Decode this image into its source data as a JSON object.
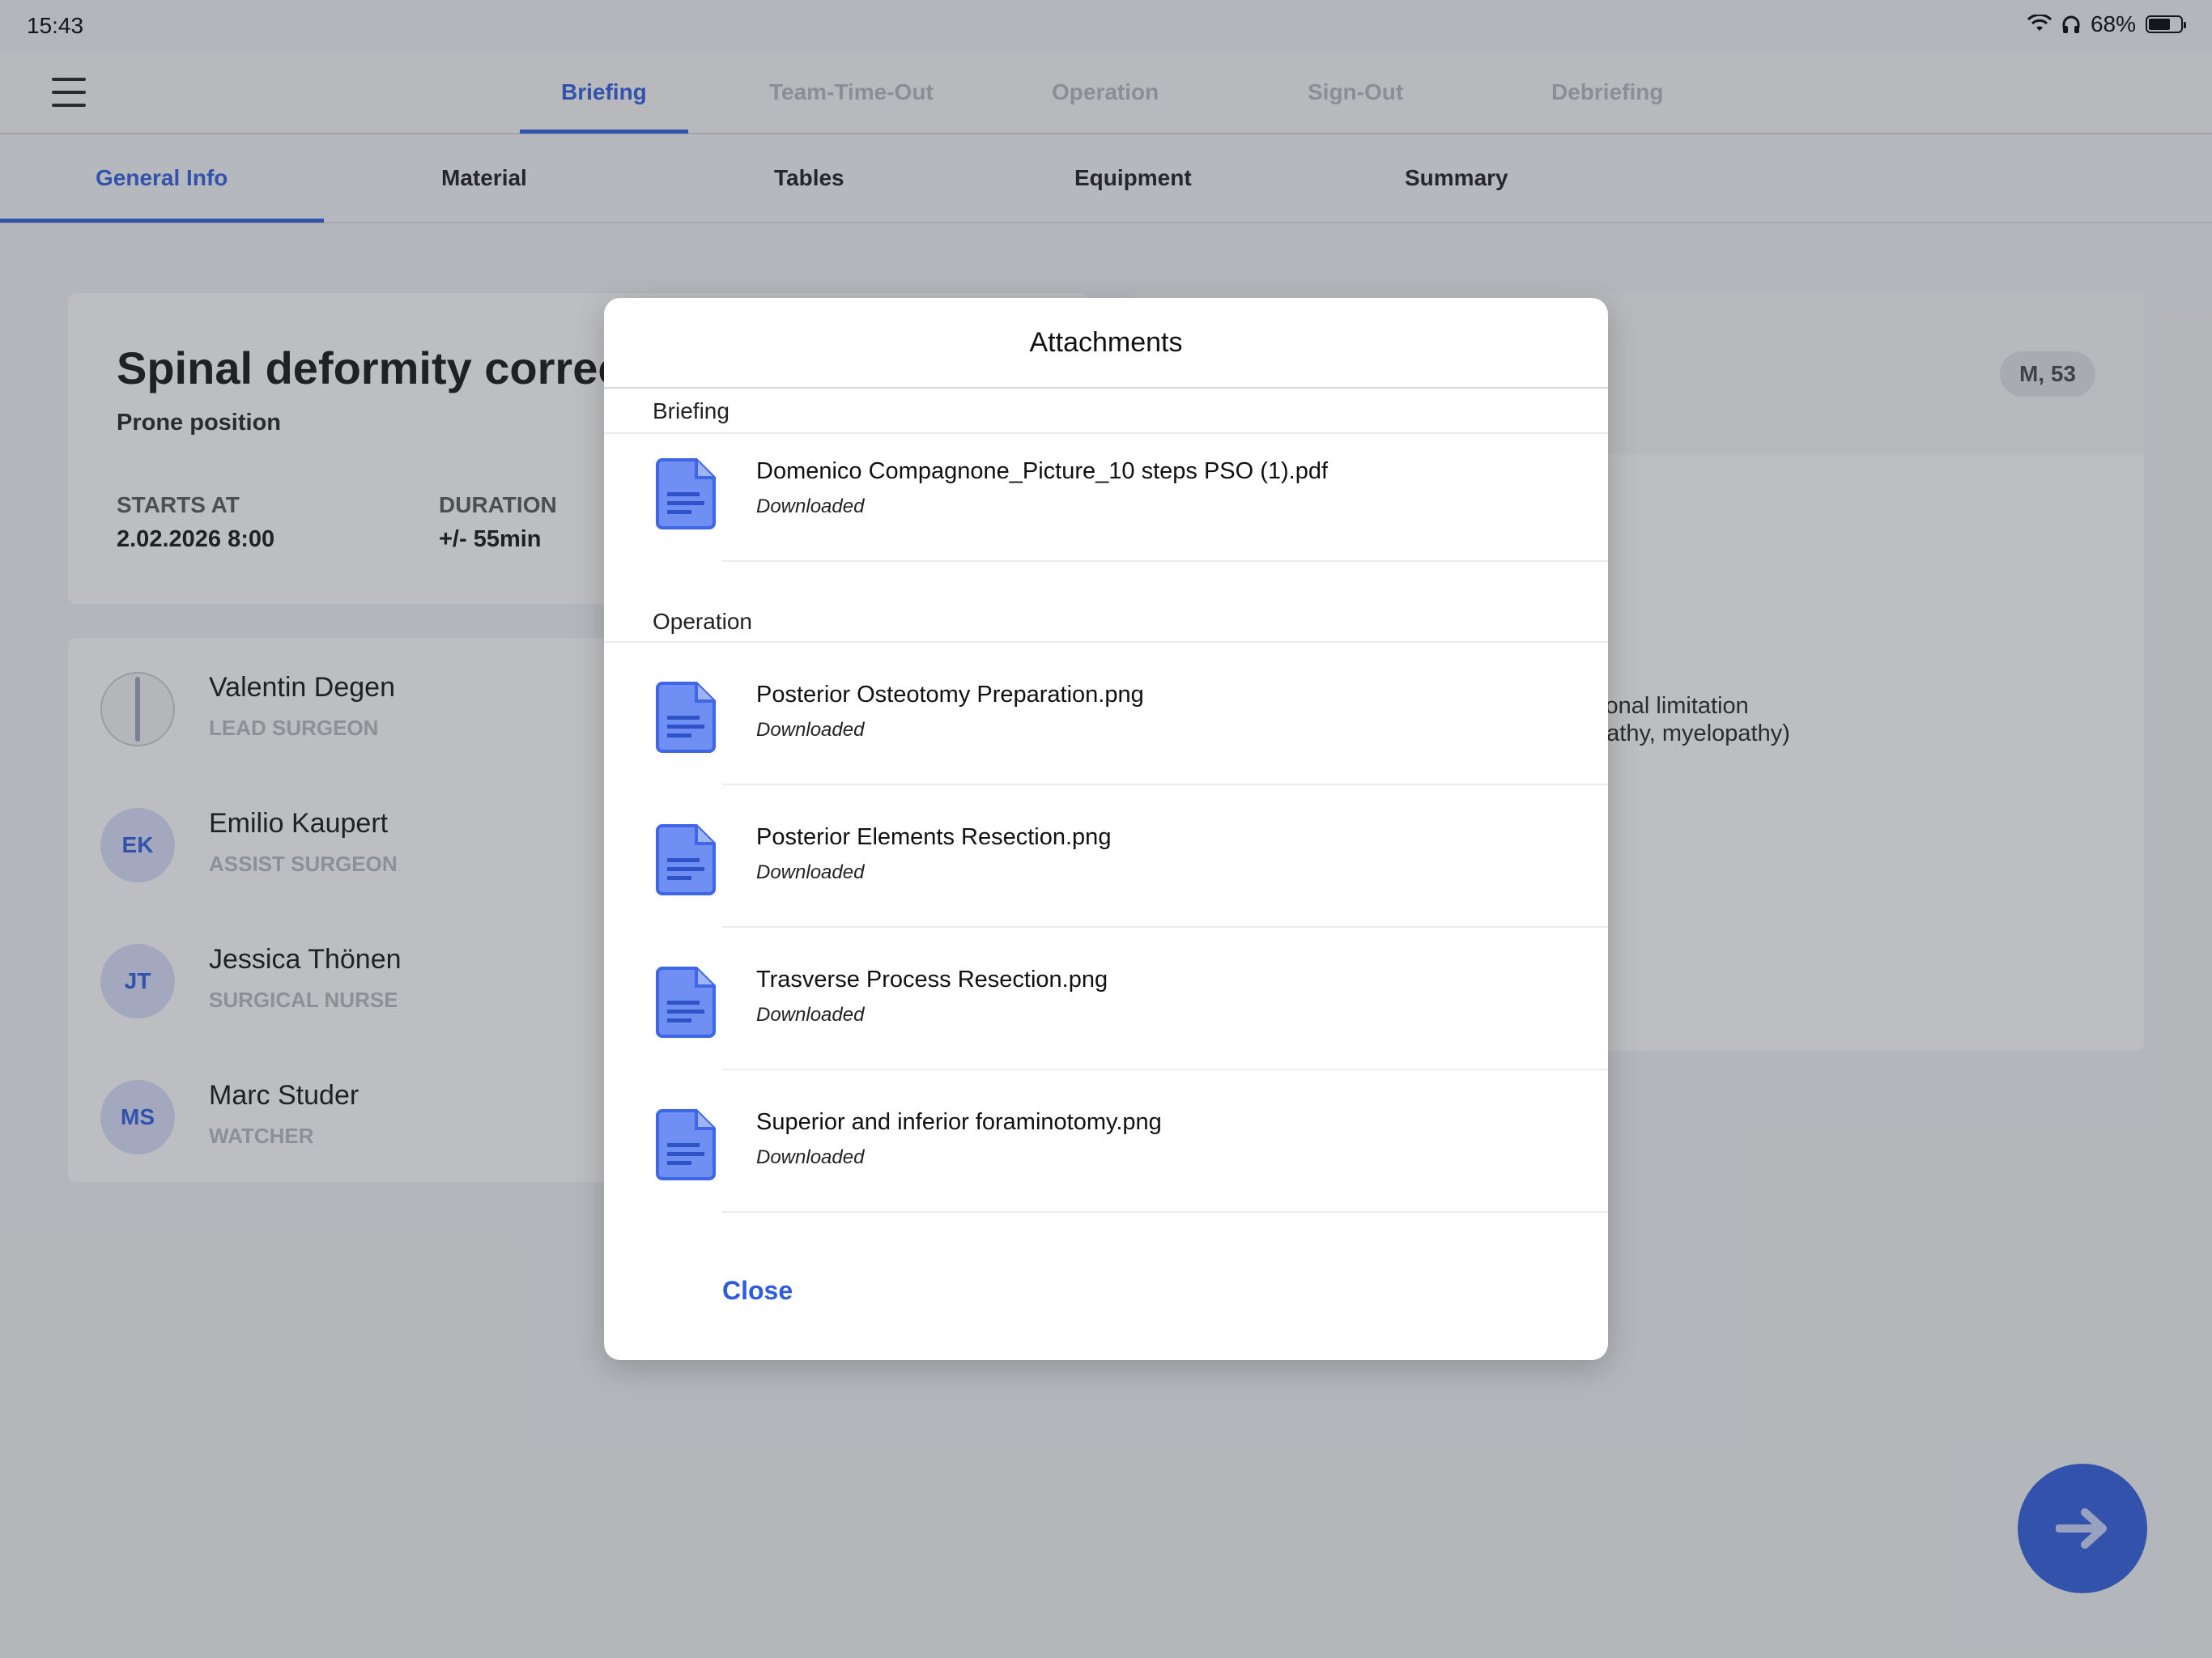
{
  "status_bar": {
    "time": "15:43",
    "battery": "68%"
  },
  "phases": [
    "Briefing",
    "Team-Time-Out",
    "Operation",
    "Sign-Out",
    "Debriefing"
  ],
  "sub_tabs": [
    "General Info",
    "Material",
    "Tables",
    "Equipment",
    "Summary"
  ],
  "procedure": {
    "title": "Spinal deformity correc",
    "position": "Prone position",
    "starts_at_label": "STARTS AT",
    "starts_at_value": "2.02.2026 8:00",
    "duration_label": "DURATION",
    "duration_value": "+/- 55min"
  },
  "patient": {
    "badge": "M, 53",
    "line1": "tional limitation",
    "line2": "pathy, myelopathy)"
  },
  "team": [
    {
      "initials": "",
      "name": "Valentin Degen",
      "role": "LEAD SURGEON"
    },
    {
      "initials": "EK",
      "name": "Emilio Kaupert",
      "role": "ASSIST SURGEON"
    },
    {
      "initials": "JT",
      "name": "Jessica Thönen",
      "role": "SURGICAL NURSE"
    },
    {
      "initials": "MS",
      "name": "Marc Studer",
      "role": "WATCHER"
    }
  ],
  "modal": {
    "title": "Attachments",
    "sections": [
      {
        "name": "Briefing",
        "files": [
          {
            "name": "Domenico Compagnone_Picture_10 steps PSO (1).pdf",
            "status": "Downloaded"
          }
        ]
      },
      {
        "name": "Operation",
        "files": [
          {
            "name": "Posterior Osteotomy Preparation.png",
            "status": "Downloaded"
          },
          {
            "name": "Posterior Elements Resection.png",
            "status": "Downloaded"
          },
          {
            "name": "Trasverse Process Resection.png",
            "status": "Downloaded"
          },
          {
            "name": "Superior and inferior foraminotomy.png",
            "status": "Downloaded"
          }
        ]
      }
    ],
    "close_label": "Close"
  },
  "icons": {
    "menu": "hamburger-icon",
    "file": "document-icon",
    "next": "arrow-right-icon",
    "wifi": "wifi-icon",
    "headphones": "headphones-icon",
    "battery": "battery-icon"
  },
  "colors": {
    "accent": "#2f5be0",
    "file_icon": "#6f8ff2"
  }
}
